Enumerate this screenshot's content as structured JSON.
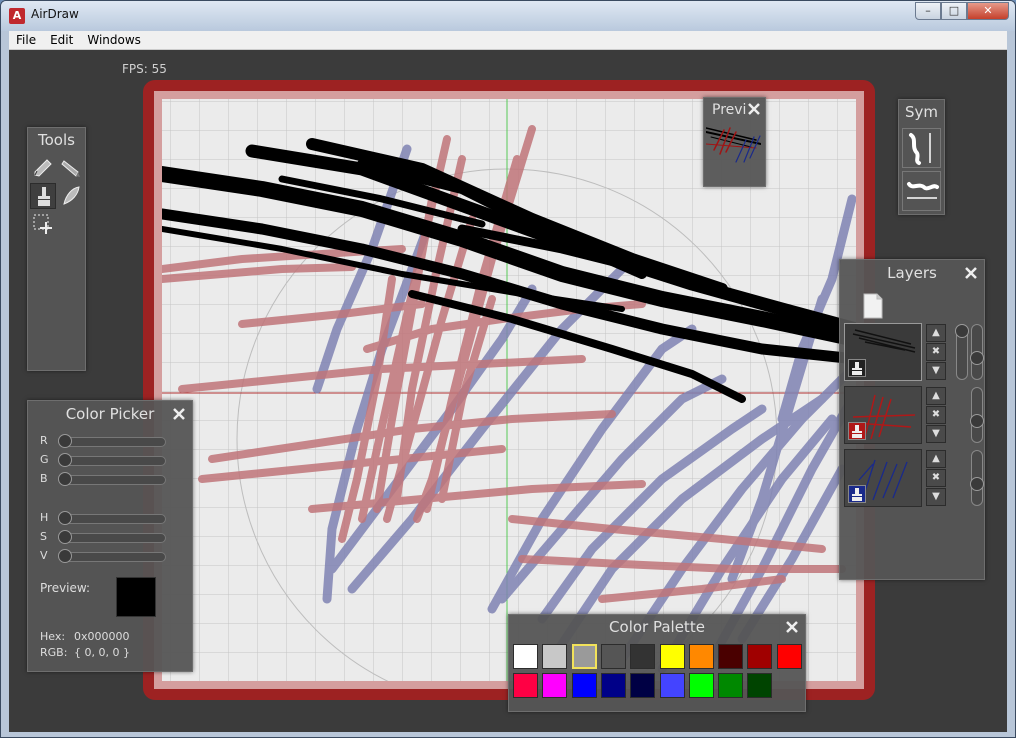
{
  "window": {
    "title": "AirDraw",
    "app_icon": "A"
  },
  "menu": [
    "File",
    "Edit",
    "Windows"
  ],
  "fps": "FPS: 55",
  "tools": {
    "title": "Tools",
    "items": [
      {
        "name": "pencil-icon",
        "active": false
      },
      {
        "name": "marker-icon",
        "active": false
      },
      {
        "name": "brush-icon",
        "active": true
      },
      {
        "name": "feather-icon",
        "active": false
      },
      {
        "name": "selection-icon",
        "active": false
      }
    ]
  },
  "preview": {
    "title": "Previ"
  },
  "sym": {
    "title": "Sym"
  },
  "layers": {
    "title": "Layers",
    "items": [
      {
        "color": "#111111",
        "badge": "#222222",
        "selected": true
      },
      {
        "color": "#b01818",
        "badge": "#b01818",
        "selected": false
      },
      {
        "color": "#1a2a8a",
        "badge": "#1a2a8a",
        "selected": false
      }
    ]
  },
  "color_picker": {
    "title": "Color Picker",
    "sliders": [
      "R",
      "G",
      "B",
      "H",
      "S",
      "V"
    ],
    "preview_label": "Preview:",
    "preview_color": "#000000",
    "hex_label": "Hex:",
    "hex_value": "0x000000",
    "rgb_label": "RGB:",
    "rgb_value": "{ 0, 0, 0 }"
  },
  "color_palette": {
    "title": "Color Palette",
    "rows": [
      [
        "#ffffff",
        "#c8c8c8",
        "#9a9a9a",
        "#555555",
        "#333333",
        "#ffff00",
        "#ff8800",
        "#4a0000",
        "#a00000",
        "#ff0000"
      ],
      [
        "#ff0044",
        "#ff00ff",
        "#0000ff",
        "#000088",
        "#000044",
        "#4444ff",
        "#00ff00",
        "#008800",
        "#004400"
      ]
    ],
    "selected": "#9a9a9a"
  },
  "colors": {
    "canvas_bg": "#ebebeb",
    "stroke_black": "#000000",
    "stroke_red": "#c0757a",
    "stroke_blue": "#7f83b3"
  }
}
